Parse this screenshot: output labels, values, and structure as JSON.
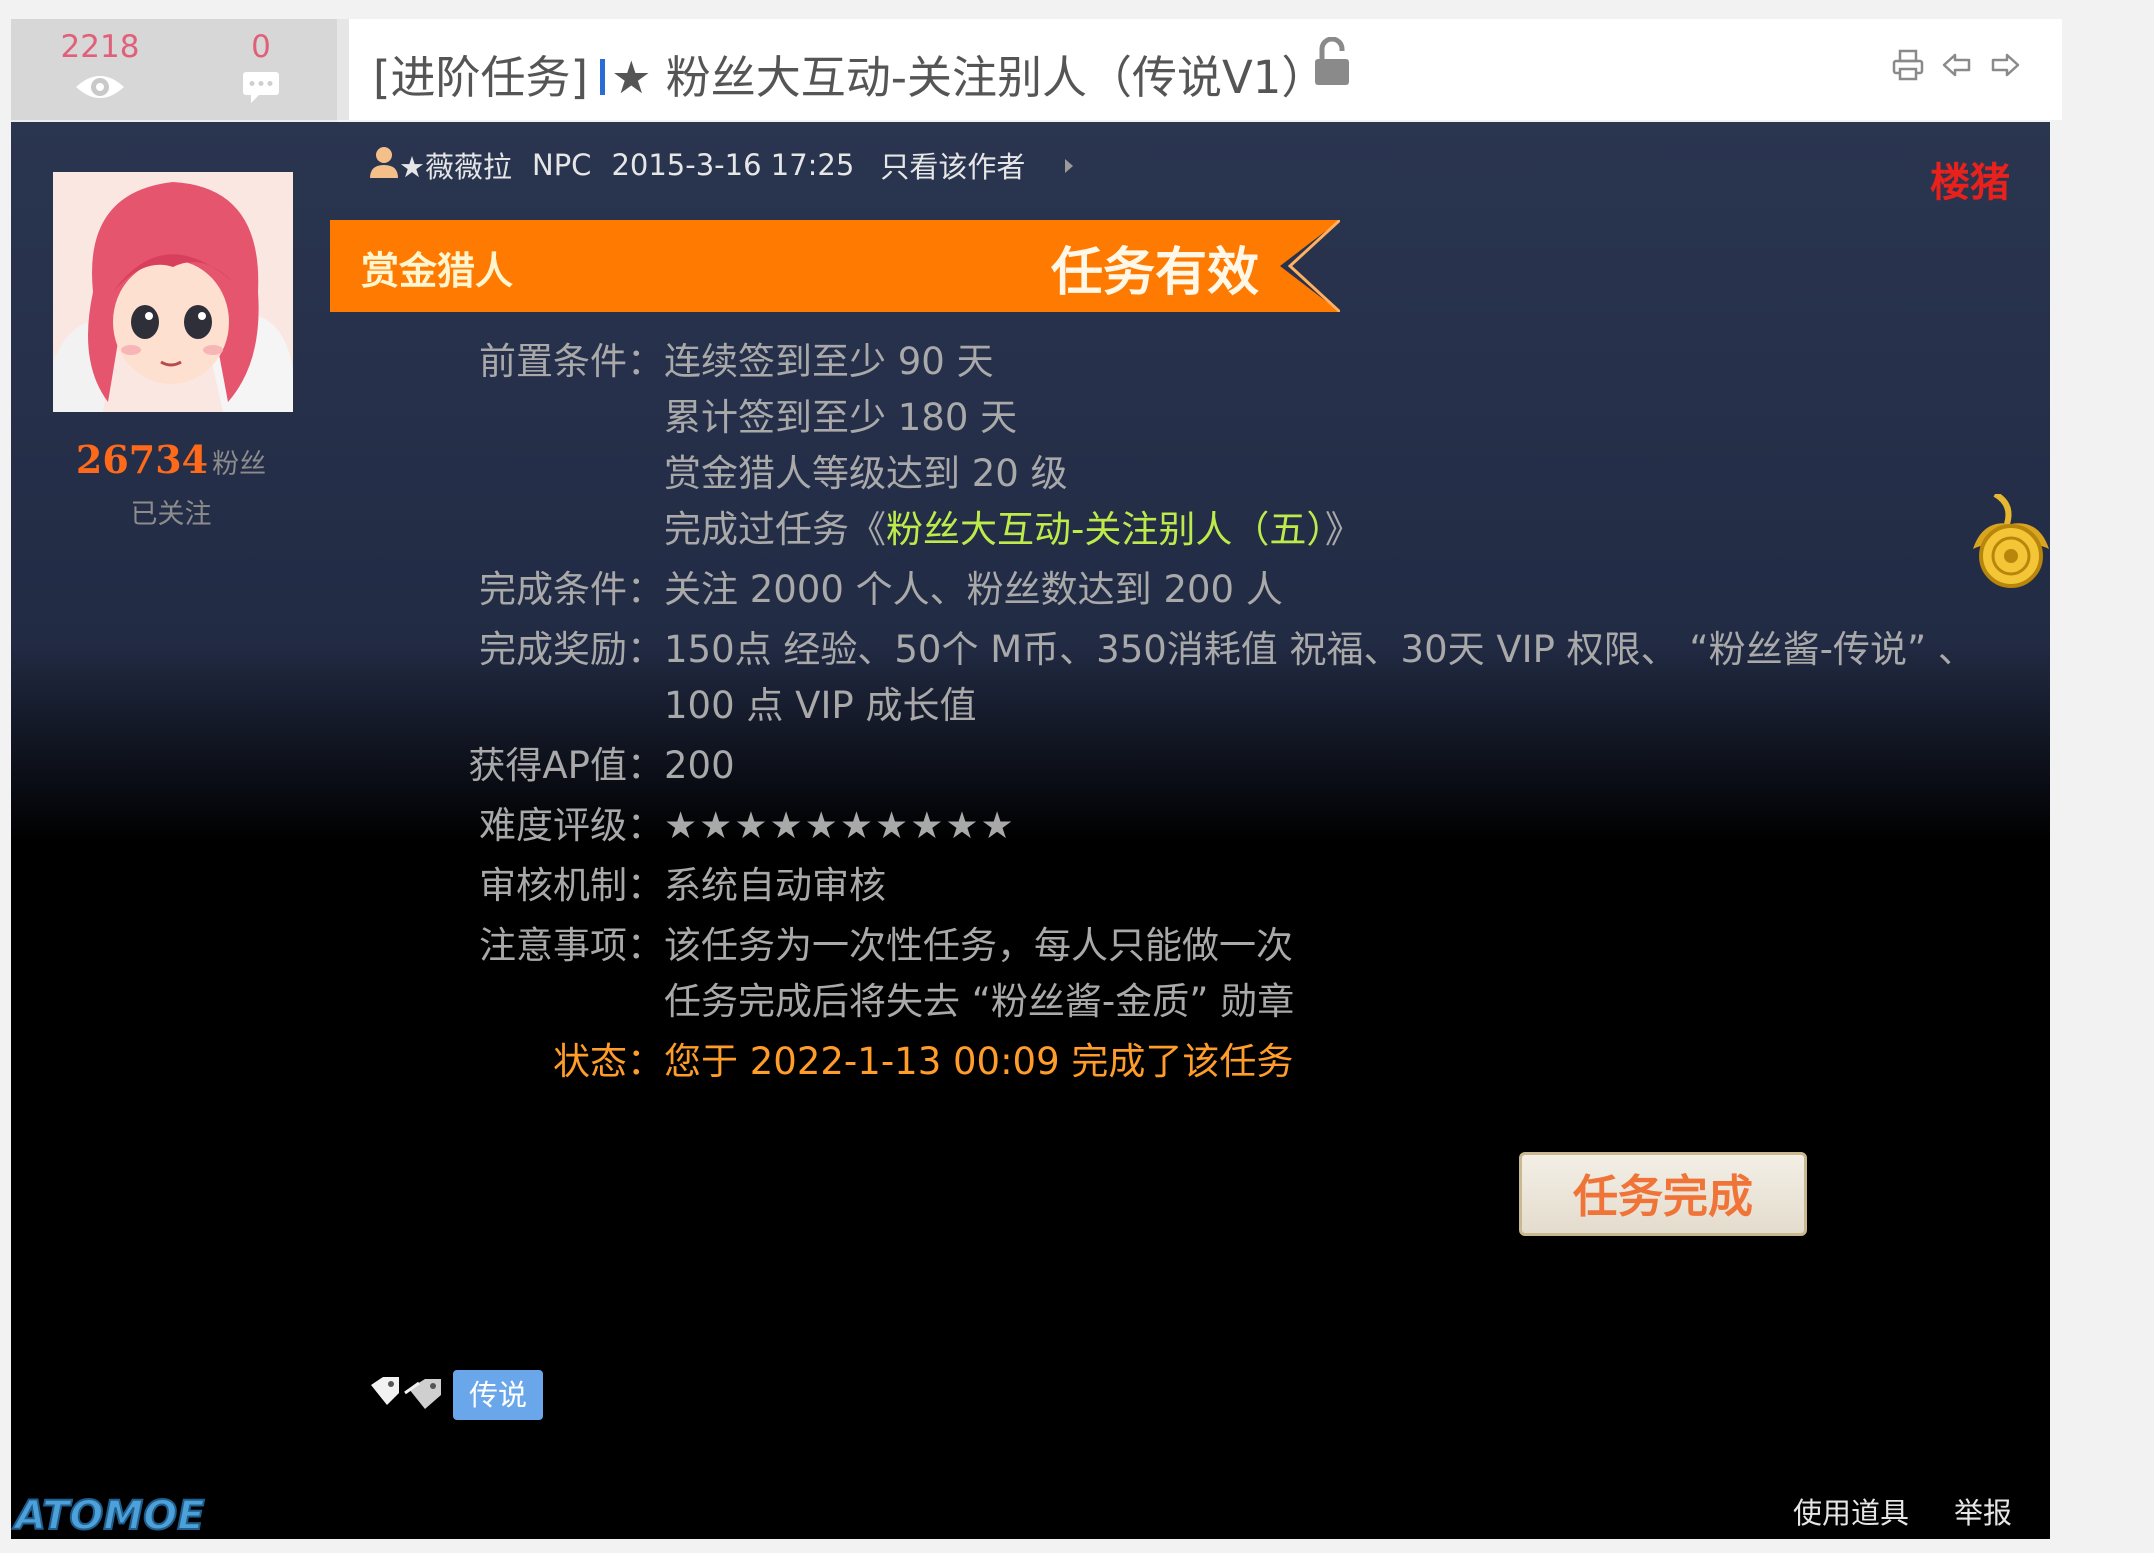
{
  "header": {
    "views": "2218",
    "replies": "0",
    "title_prefix": "[进阶任务]",
    "title_main": "★ 粉丝大互动-关注别人（传说V1）"
  },
  "author": {
    "fans_count": "26734",
    "fans_label": "粉丝",
    "follow_status": "已关注"
  },
  "post": {
    "author_name": "★薇薇拉",
    "author_role": "NPC",
    "date": "2015-3-16 17:25",
    "only_author_link": "只看该作者",
    "floor_badge": "楼猪"
  },
  "task": {
    "category": "赏金猎人",
    "validity": "任务有效",
    "rows": [
      {
        "label": "前置条件：",
        "values": [
          "连续签到至少 90 天",
          "累计签到至少 180 天",
          "赏金猎人等级达到 20 级"
        ]
      },
      {
        "label": "完成条件：",
        "values": [
          "关注 2000 个人、粉丝数达到 200 人"
        ]
      },
      {
        "label": "完成奖励：",
        "values": [
          "150点 经验、50个 M币、350消耗值 祝福、30天 VIP 权限、 “粉丝酱-传说” 、",
          "100 点 VIP 成长值"
        ]
      },
      {
        "label": "获得AP值：",
        "values": [
          "200"
        ]
      },
      {
        "label": "难度评级：",
        "values": [
          "★★★★★★★★★★"
        ]
      },
      {
        "label": "审核机制：",
        "values": [
          "系统自动审核"
        ]
      },
      {
        "label": "注意事项：",
        "values": [
          "该任务为一次性任务，每人只能做一次",
          "任务完成后将失去 “粉丝酱-金质” 勋章"
        ]
      }
    ],
    "prereq_task_prefix": "完成过任务《",
    "prereq_task_name": "粉丝大互动-关注别人（五）",
    "prereq_task_suffix": "》",
    "status_label": "状态：",
    "status_value": "您于 2022-1-13 00:09 完成了该任务",
    "complete_button": "任务完成"
  },
  "tags": [
    "传说"
  ],
  "footer": {
    "use_item": "使用道具",
    "report": "举报",
    "watermark": "ATOMOE"
  },
  "colors": {
    "ribbon": "#ff7a00",
    "status": "#ff9c2a",
    "highlight": "#bdeb4a",
    "badge_red": "#e8211c"
  }
}
